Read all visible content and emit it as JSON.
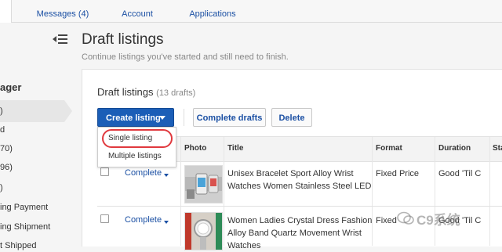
{
  "topnav": {
    "tabs": [
      {
        "label": "Messages (4)"
      },
      {
        "label": "Account"
      },
      {
        "label": "Applications"
      }
    ]
  },
  "sidebar": {
    "heading": "ager",
    "items": [
      {
        "label": ")"
      },
      {
        "label": "d"
      },
      {
        "label": "70)"
      },
      {
        "label": "96)"
      },
      {
        "label": ")"
      },
      {
        "label": "ing Payment"
      },
      {
        "label": "ing Shipment"
      },
      {
        "label": "t Shipped"
      }
    ]
  },
  "page": {
    "title": "Draft listings",
    "subtitle": "Continue listings you've started and still need to finish."
  },
  "panel": {
    "title": "Draft listings",
    "count": "(13 drafts)",
    "create_label": "Create listing",
    "complete_drafts_label": "Complete drafts",
    "delete_label": "Delete",
    "dropdown": [
      {
        "label": "Single listing"
      },
      {
        "label": "Multiple listings"
      }
    ]
  },
  "table": {
    "columns": [
      "Photo",
      "Title",
      "Format",
      "Duration",
      "Sta"
    ],
    "rows": [
      {
        "action": "Complete",
        "title_line1": "Unisex Bracelet Sport Alloy Wrist",
        "title_line2": "Watches Women Stainless Steel LED",
        "title_line3": "",
        "format": "Fixed Price",
        "duration": "Good 'Til C"
      },
      {
        "action": "Complete",
        "title_line1": "Women Ladies Crystal Dress Fashion",
        "title_line2": "Alloy Band Quartz Movement Wrist",
        "title_line3": "Watches",
        "format": "Fixed",
        "duration": "Good 'Til C"
      }
    ]
  },
  "watermark": {
    "text": "C9系统"
  },
  "colors": {
    "accent": "#1b5eb7",
    "link": "#1a4fa3",
    "highlight": "#e0393e"
  }
}
